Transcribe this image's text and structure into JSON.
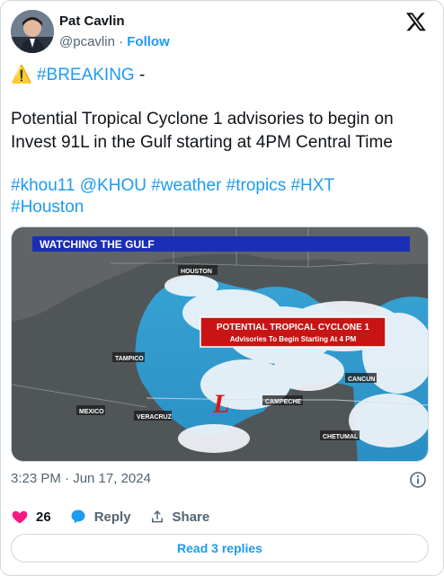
{
  "author": {
    "name": "Pat Cavlin",
    "handle": "@pcavlin",
    "separator": "·",
    "follow_label": "Follow"
  },
  "tweet": {
    "line1_emoji": "⚠️",
    "line1_tag": "#BREAKING",
    "line1_suffix": " -",
    "body_line1": "Potential Tropical Cyclone 1 advisories to begin on",
    "body_line2": "Invest 91L in the Gulf starting at 4PM Central Time",
    "tags_line1": "#khou11 @KHOU #weather #tropics #HXT",
    "tags_line2": "#Houston"
  },
  "media": {
    "banner": "WATCHING THE GULF",
    "alert_title": "POTENTIAL TROPICAL CYCLONE 1",
    "alert_subtitle": "Advisories To Begin Starting At 4 PM",
    "storm_symbol": "L",
    "places": {
      "houston": "HOUSTON",
      "tampico": "TAMPICO",
      "mexico": "MEXICO",
      "veracruz": "VERACRUZ",
      "campeche": "CAMPECHE",
      "cancun": "CANCUN",
      "chetumal": "CHETUMAL"
    }
  },
  "meta": {
    "timestamp": "3:23 PM · Jun 17, 2024"
  },
  "actions": {
    "like_count": "26",
    "reply_label": "Reply",
    "share_label": "Share"
  },
  "read_replies_label": "Read 3 replies",
  "colors": {
    "link": "#1d9bf0",
    "like": "#f91880",
    "banner": "#1a2fb5",
    "alert": "#c81414"
  }
}
